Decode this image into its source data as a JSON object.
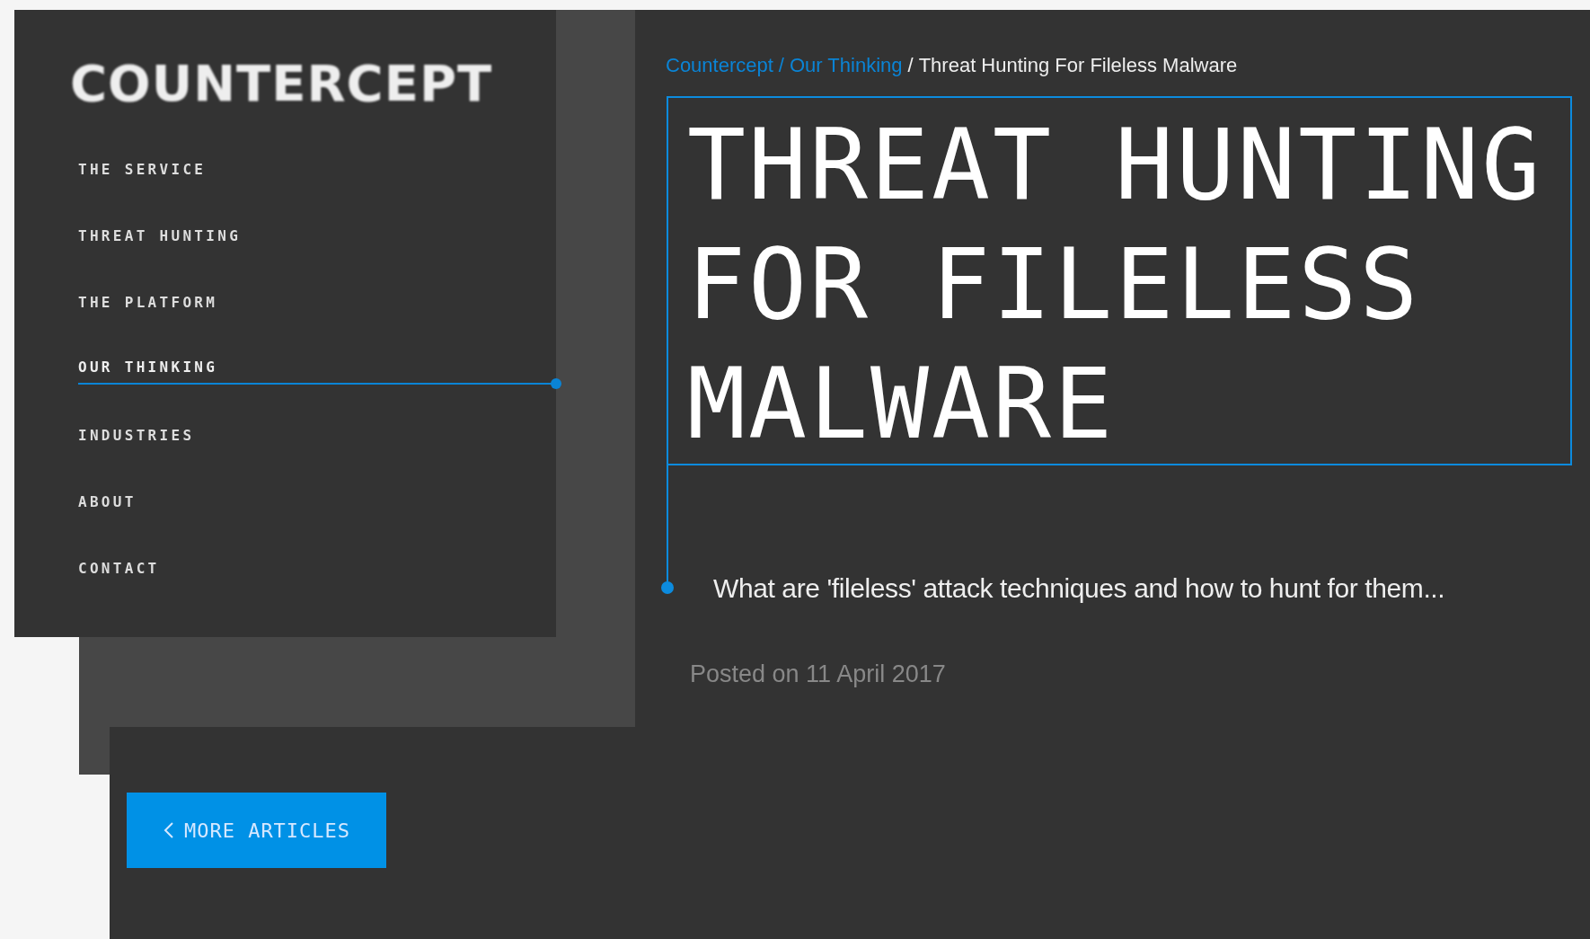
{
  "logo": "COUNTERCEPT",
  "nav": [
    {
      "label": "THE SERVICE",
      "selected": false
    },
    {
      "label": "THREAT HUNTING",
      "selected": false
    },
    {
      "label": "THE PLATFORM",
      "selected": false
    },
    {
      "label": "OUR THINKING",
      "selected": true
    },
    {
      "label": "INDUSTRIES",
      "selected": false
    },
    {
      "label": "ABOUT",
      "selected": false
    },
    {
      "label": "CONTACT",
      "selected": false
    }
  ],
  "breadcrumb": {
    "separator": "/",
    "items": [
      {
        "label": "Countercept",
        "link": true
      },
      {
        "label": "Our Thinking",
        "link": true
      },
      {
        "label": "Threat Hunting For Fileless Malware",
        "link": false
      }
    ]
  },
  "title": [
    "THREAT HUNTING",
    "FOR FILELESS",
    "MALWARE"
  ],
  "subtitle": "What are 'fileless' attack techniques and how to hunt for them...",
  "posted": "Posted on 11 April 2017",
  "back_button": {
    "label": "MORE ARTICLES"
  }
}
